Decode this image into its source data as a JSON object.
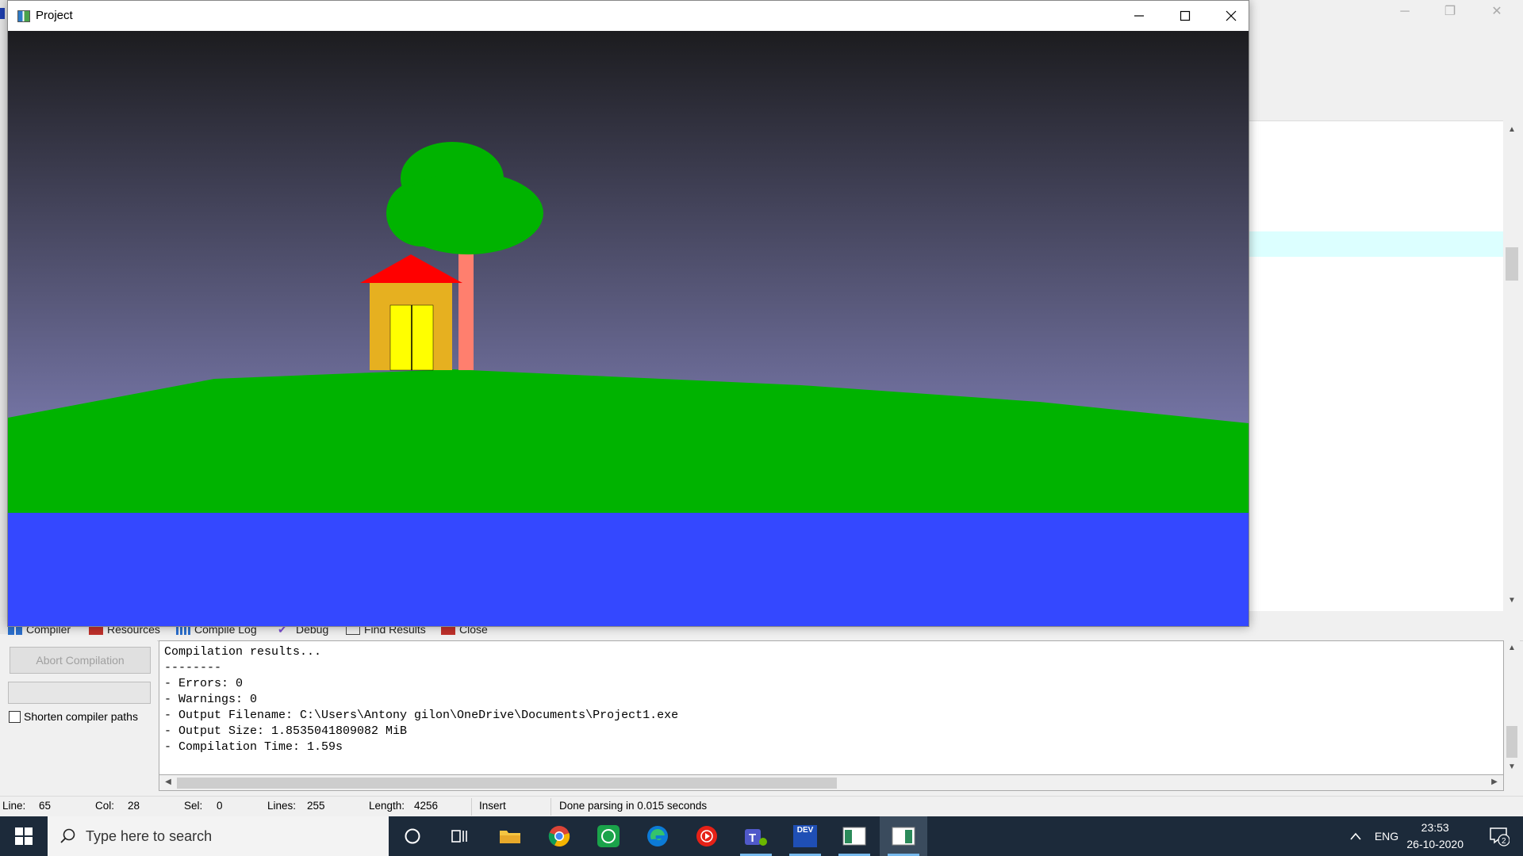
{
  "ide": {
    "tabs": [
      {
        "label": "Compiler",
        "icon": "compiler-icon"
      },
      {
        "label": "Resources",
        "icon": "resources-icon"
      },
      {
        "label": "Compile Log",
        "icon": "compile-log-icon"
      },
      {
        "label": "Debug",
        "icon": "debug-icon"
      },
      {
        "label": "Find Results",
        "icon": "find-results-icon"
      },
      {
        "label": "Close",
        "icon": "close-tab-icon"
      }
    ],
    "abort_button": "Abort Compilation",
    "shorten_label": "Shorten compiler paths",
    "log_lines": [
      "Compilation results...",
      "--------",
      "- Errors: 0",
      "- Warnings: 0",
      "- Output Filename: C:\\Users\\Antony gilon\\OneDrive\\Documents\\Project1.exe",
      "- Output Size: 1.8535041809082 MiB",
      "- Compilation Time: 1.59s"
    ],
    "status": {
      "line_label": "Line:",
      "line_value": "65",
      "col_label": "Col:",
      "col_value": "28",
      "sel_label": "Sel:",
      "sel_value": "0",
      "lines_label": "Lines:",
      "lines_value": "255",
      "length_label": "Length:",
      "length_value": "4256",
      "mode": "Insert",
      "message": "Done parsing in 0.015 seconds"
    }
  },
  "project_window": {
    "title": "Project",
    "colors": {
      "sky_top": "#1c1c1f",
      "sky_bottom": "#7c7cb0",
      "ground": "#00b300",
      "water": "#3448ff",
      "house_wall": "#e6b020",
      "house_roof": "#ff0000",
      "door": "#ffff00",
      "trunk": "#ff7f6e",
      "foliage": "#00b300"
    }
  },
  "taskbar": {
    "search_placeholder": "Type here to search",
    "apps": [
      "cortana-icon",
      "task-view-icon",
      "file-explorer-icon",
      "chrome-icon",
      "whatsapp-icon",
      "edge-icon",
      "youtube-music-icon",
      "teams-icon",
      "devcpp-icon",
      "app-window-icon",
      "project-window-icon"
    ],
    "devcpp_label": "DEV",
    "tray": {
      "language": "ENG",
      "time": "23:53",
      "date": "26-10-2020",
      "notification_count": "2"
    }
  }
}
